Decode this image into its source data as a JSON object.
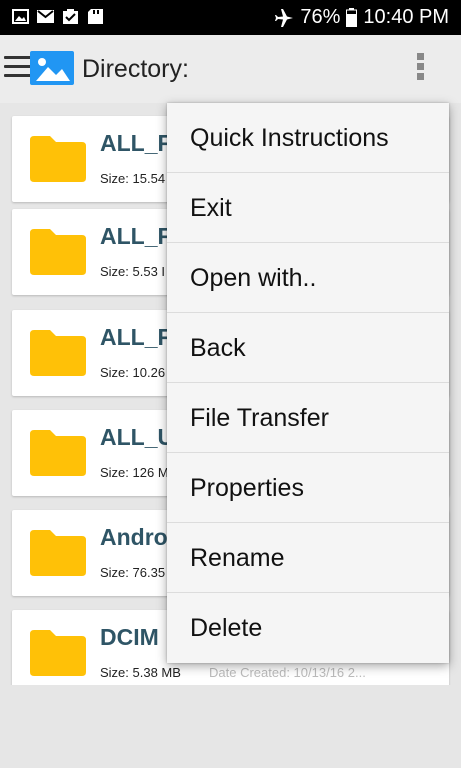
{
  "status_bar": {
    "icons": [
      "image-icon",
      "mail-icon",
      "clipboard-check-icon",
      "sd-card-icon"
    ],
    "airplane_icon": "airplane-icon",
    "battery_percent": "76%",
    "battery_icon": "battery-icon",
    "time": "10:40 PM"
  },
  "app_bar": {
    "title": "Directory:",
    "menu_icon": "hamburger-icon",
    "logo_icon": "image-icon",
    "overflow_icon": "overflow-icon"
  },
  "files": [
    {
      "name": "ALL_F",
      "size": "Size: 15.54",
      "date": ""
    },
    {
      "name": "ALL_F",
      "size": "Size: 5.53 I",
      "date": ""
    },
    {
      "name": "ALL_F",
      "size": "Size: 10.26",
      "date": ""
    },
    {
      "name": "ALL_U",
      "size": "Size: 126 M",
      "date": ""
    },
    {
      "name": "Andro",
      "size": "Size: 76.35",
      "date": ""
    },
    {
      "name": "DCIM",
      "size": "Size: 5.38 MB",
      "date": "Date Created: 10/13/16 2..."
    }
  ],
  "menu": {
    "items": [
      "Quick Instructions",
      "Exit",
      "Open with..",
      "Back",
      "File Transfer",
      "Properties",
      "Rename",
      "Delete"
    ]
  },
  "colors": {
    "folder": "#ffc107",
    "title_text": "#2f5566",
    "logo_accent": "#2196f3"
  }
}
